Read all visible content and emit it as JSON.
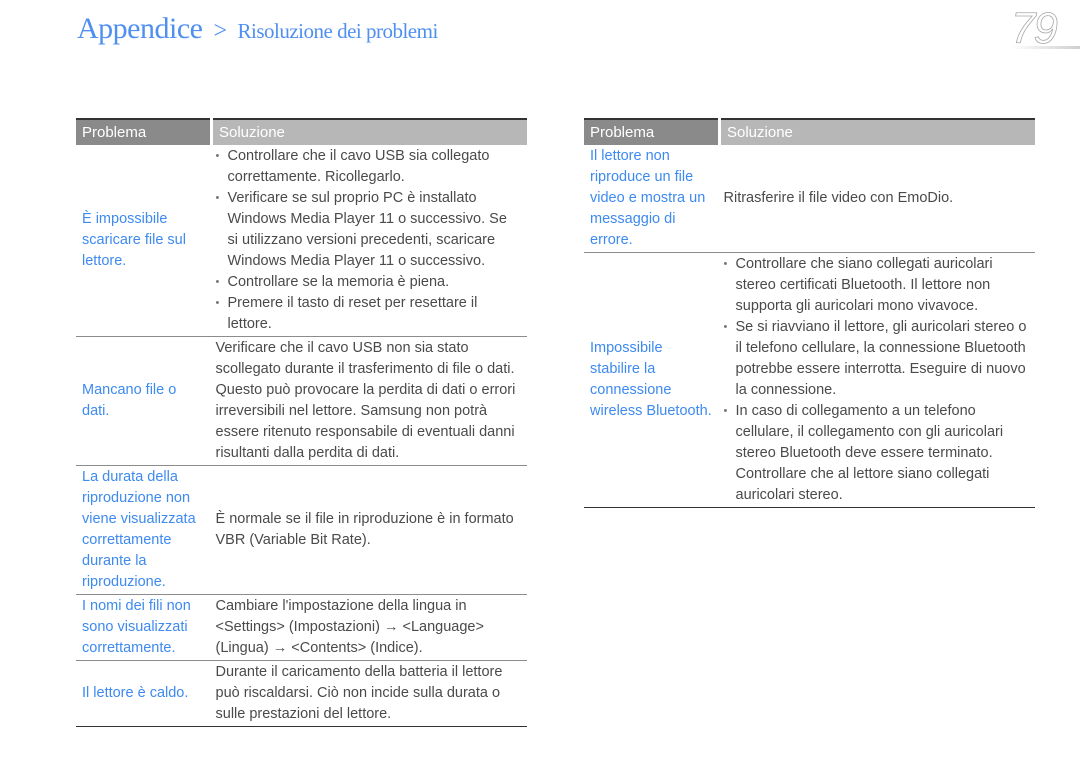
{
  "header": {
    "section": "Appendice",
    "separator": ">",
    "subsection": "Risoluzione dei problemi",
    "page_number": "79"
  },
  "table_headers": {
    "problem": "Problema",
    "solution": "Soluzione"
  },
  "left_table": {
    "rows": [
      {
        "problem": "È impossibile scaricare file sul lettore.",
        "solution_bullets": [
          "Controllare che il cavo USB sia collegato correttamente. Ricollegarlo.",
          "Verificare se sul proprio PC è installato Windows Media Player 11 o successivo. Se si utilizzano versioni precedenti, scaricare Windows Media Player 11 o successivo.",
          "Controllare se la memoria è piena.",
          "Premere il tasto di reset per resettare il lettore."
        ]
      },
      {
        "problem": "Mancano file o dati.",
        "solution": "Verificare che il cavo USB non sia stato scollegato durante il trasferimento di file o dati. Questo può provocare la perdita di dati o errori irreversibili nel lettore. Samsung non potrà essere ritenuto responsabile di eventuali danni risultanti dalla perdita di dati."
      },
      {
        "problem": "La durata della riproduzione non viene visualizzata correttamente durante la riproduzione.",
        "solution": "È normale se il file in riproduzione è in formato VBR (Variable Bit Rate)."
      },
      {
        "problem": "I nomi dei fili non sono visualizzati correttamente.",
        "solution": "Cambiare l'impostazione della lingua in <Settings> (Impostazioni) → <Language> (Lingua) → <Contents> (Indice)."
      },
      {
        "problem": "Il lettore è caldo.",
        "solution": "Durante il caricamento della batteria il lettore può riscaldarsi. Ciò non incide sulla durata o sulle prestazioni del lettore."
      }
    ]
  },
  "right_table": {
    "rows": [
      {
        "problem": "Il lettore non riproduce un file video e mostra un messaggio di errore.",
        "solution": "Ritrasferire il file video con EmoDio."
      },
      {
        "problem": "Impossibile stabilire la connessione wireless Bluetooth.",
        "solution_bullets": [
          "Controllare che siano collegati auricolari stereo certificati Bluetooth. Il lettore non supporta gli auricolari mono vivavoce.",
          "Se si riavviano il lettore, gli auricolari stereo o il telefono cellulare, la connessione Bluetooth potrebbe essere interrotta. Eseguire di nuovo la connessione.",
          "In caso di collegamento a un telefono cellulare, il collegamento con gli auricolari stereo Bluetooth deve essere terminato. Controllare che al lettore siano collegati auricolari stereo."
        ]
      }
    ]
  },
  "colors": {
    "accent_blue": "#4f8ff0",
    "problem_text": "#3d8af0",
    "header_problem_bg": "#8a8a8a",
    "header_solution_bg": "#b7b7b7"
  }
}
